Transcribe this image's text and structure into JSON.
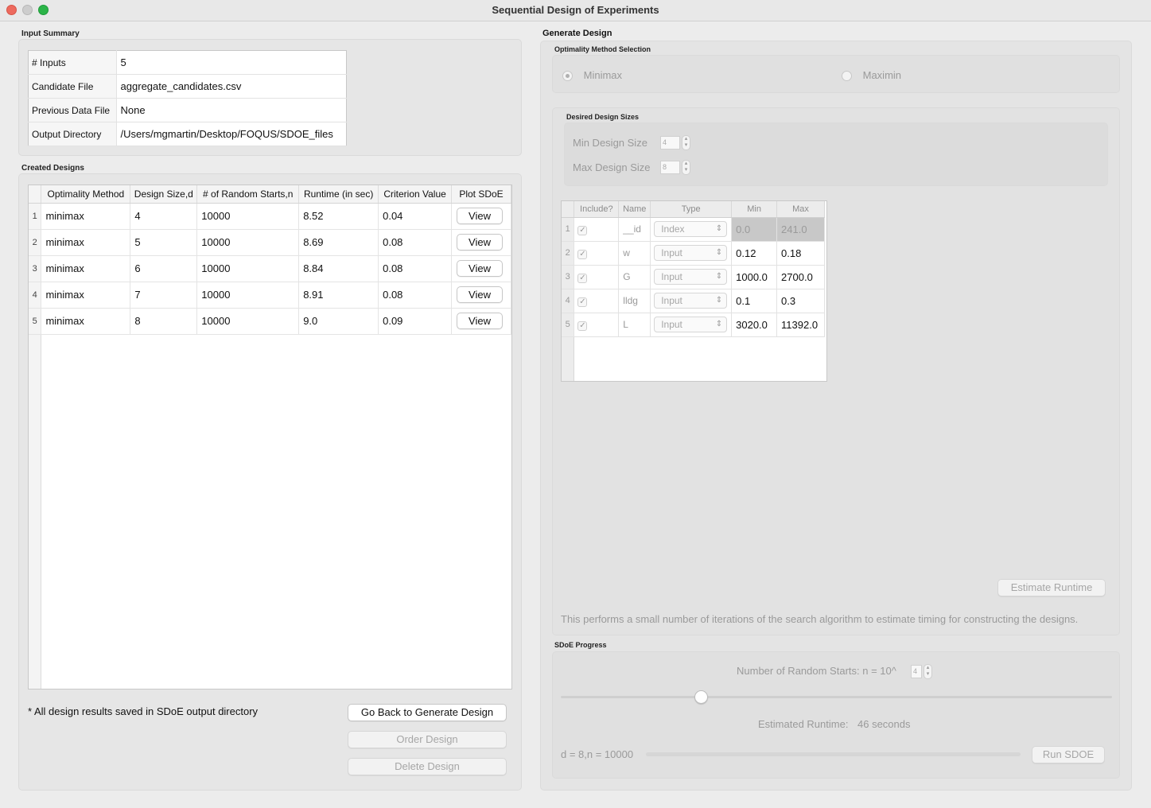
{
  "window": {
    "title": "Sequential Design of Experiments"
  },
  "input_summary": {
    "title": "Input Summary",
    "rows": [
      {
        "label": "# Inputs",
        "value": "5"
      },
      {
        "label": "Candidate File",
        "value": "aggregate_candidates.csv"
      },
      {
        "label": "Previous Data File",
        "value": "None"
      },
      {
        "label": "Output Directory",
        "value": "/Users/mgmartin/Desktop/FOQUS/SDOE_files"
      }
    ]
  },
  "created_designs": {
    "title": "Created Designs",
    "columns": [
      "Optimality Method",
      "Design Size,d",
      "# of Random Starts,n",
      "Runtime (in sec)",
      "Criterion Value",
      "Plot SDoE"
    ],
    "rows": [
      {
        "n": "1",
        "method": "minimax",
        "size": "4",
        "starts": "10000",
        "runtime": "8.52",
        "criterion": "0.04",
        "action": "View"
      },
      {
        "n": "2",
        "method": "minimax",
        "size": "5",
        "starts": "10000",
        "runtime": "8.69",
        "criterion": "0.08",
        "action": "View"
      },
      {
        "n": "3",
        "method": "minimax",
        "size": "6",
        "starts": "10000",
        "runtime": "8.84",
        "criterion": "0.08",
        "action": "View"
      },
      {
        "n": "4",
        "method": "minimax",
        "size": "7",
        "starts": "10000",
        "runtime": "8.91",
        "criterion": "0.08",
        "action": "View"
      },
      {
        "n": "5",
        "method": "minimax",
        "size": "8",
        "starts": "10000",
        "runtime": "9.0",
        "criterion": "0.09",
        "action": "View"
      }
    ],
    "note": "* All design results saved in SDoE output directory",
    "buttons": {
      "back": "Go Back to Generate Design",
      "order": "Order Design",
      "delete": "Delete Design"
    }
  },
  "generate_design": {
    "title": "Generate Design",
    "optimality": {
      "title": "Optimality Method Selection",
      "options": [
        "Minimax",
        "Maximin"
      ],
      "selected": "Minimax"
    },
    "sizes": {
      "title": "Desired Design Sizes",
      "min_label": "Min Design Size",
      "min_value": "4",
      "max_label": "Max Design Size",
      "max_value": "8"
    },
    "inputs_table": {
      "columns": [
        "Include?",
        "Name",
        "Type",
        "Min",
        "Max"
      ],
      "rows": [
        {
          "n": "1",
          "include": true,
          "name": "__id",
          "type": "Index",
          "min": "0.0",
          "max": "241.0"
        },
        {
          "n": "2",
          "include": true,
          "name": "w",
          "type": "Input",
          "min": "0.12",
          "max": "0.18"
        },
        {
          "n": "3",
          "include": true,
          "name": "G",
          "type": "Input",
          "min": "1000.0",
          "max": "2700.0"
        },
        {
          "n": "4",
          "include": true,
          "name": "lldg",
          "type": "Input",
          "min": "0.1",
          "max": "0.3"
        },
        {
          "n": "5",
          "include": true,
          "name": "L",
          "type": "Input",
          "min": "3020.0",
          "max": "11392.0"
        }
      ]
    },
    "estimate_button": "Estimate Runtime",
    "estimate_note": "This performs a small number of iterations of the search algorithm to estimate timing for constructing the designs."
  },
  "progress": {
    "title": "SDoE Progress",
    "random_starts_label": "Number of Random Starts: n = 10^",
    "random_starts_exp": "4",
    "estimated_runtime_label": "Estimated Runtime:",
    "estimated_runtime_value": "46 seconds",
    "status": "d = 8,n = 10000",
    "run_button": "Run SDOE"
  },
  "colors": {
    "close": "#ed6a5e",
    "minimize": "#c8c8c8",
    "zoom": "#2bb448"
  }
}
